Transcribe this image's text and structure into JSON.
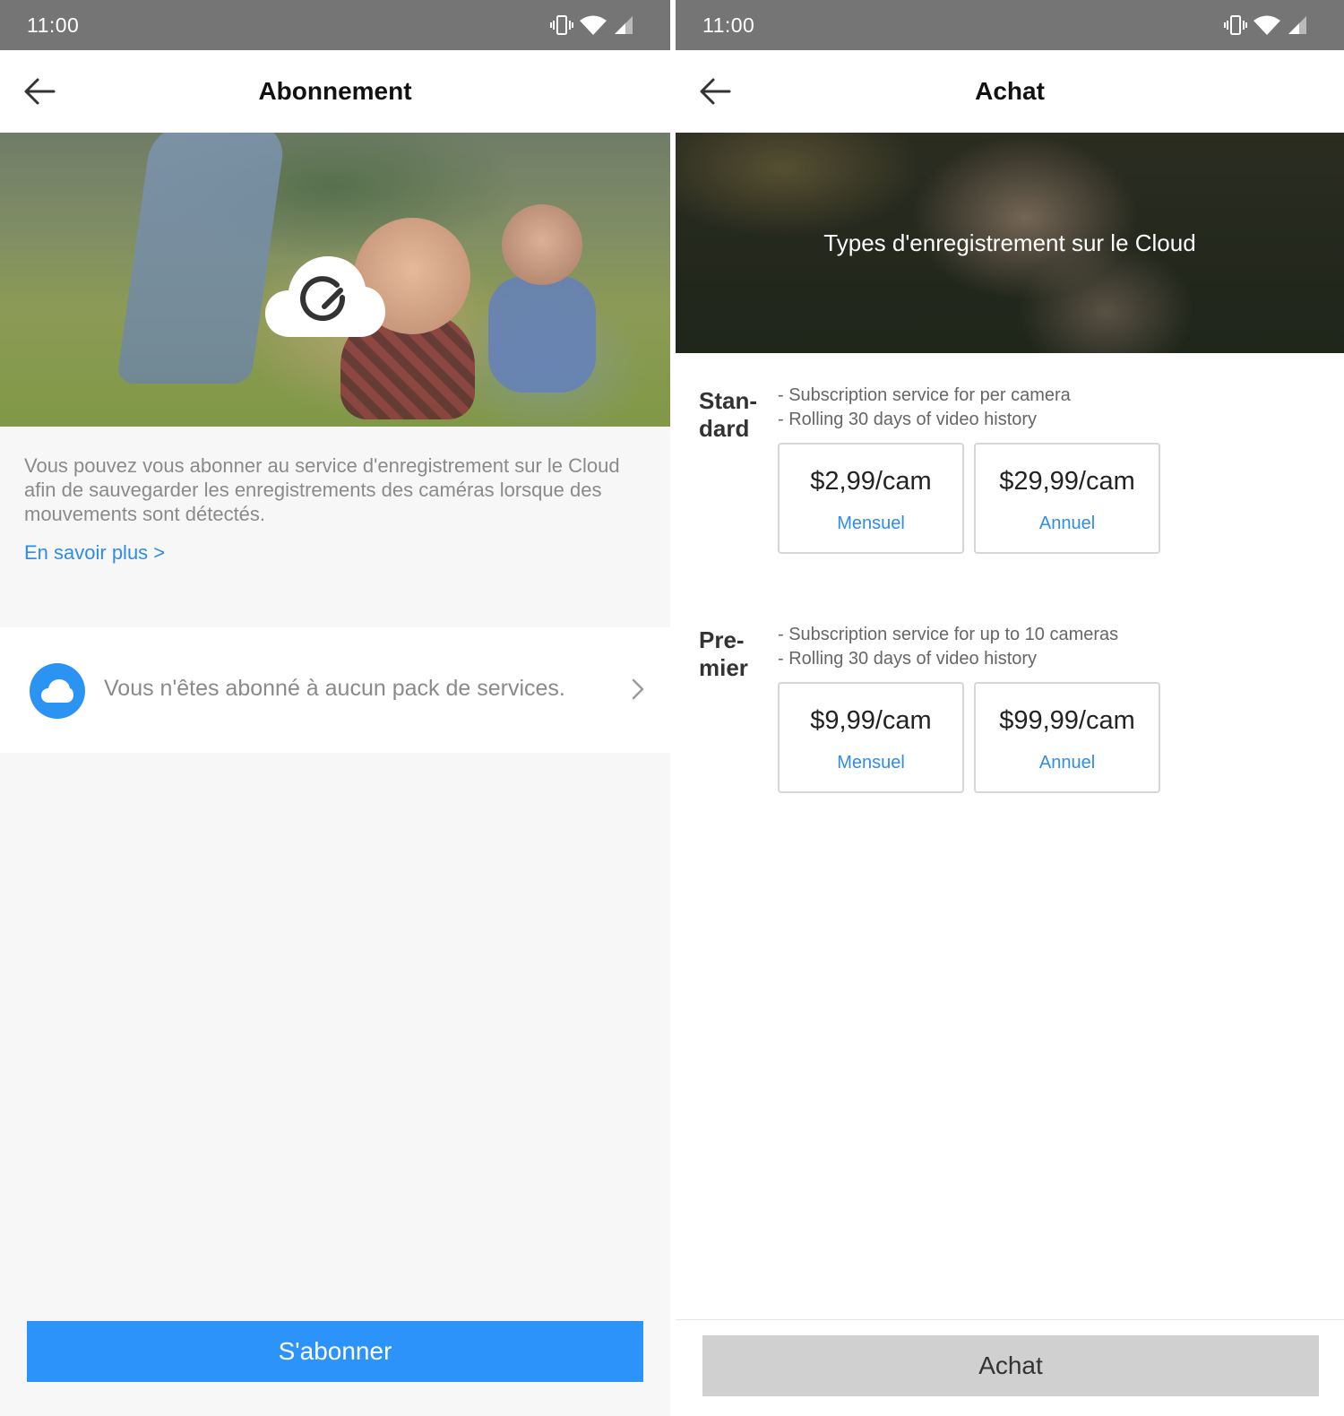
{
  "left_screen": {
    "status_bar": {
      "time": "11:00"
    },
    "app_bar": {
      "title": "Abonnement"
    },
    "description": "Vous pouvez vous abonner au service d'enregistrement sur le Cloud afin de sauvegarder les enregistrements des caméras lorsque des mouvements sont détectés.",
    "learn_more": "En savoir plus >",
    "subscription_status": "Vous n'êtes abonné à aucun pack de services.",
    "subscribe_button": "S'abonner"
  },
  "right_screen": {
    "status_bar": {
      "time": "11:00"
    },
    "app_bar": {
      "title": "Achat"
    },
    "hero_title": "Types d'enregistrement sur le Cloud",
    "plans": [
      {
        "name_line1": "Stan-",
        "name_line2": "dard",
        "features": [
          "- Subscription service for per camera",
          "- Rolling 30 days of video history"
        ],
        "options": [
          {
            "price": "$2,99/cam",
            "period": "Mensuel"
          },
          {
            "price": "$29,99/cam",
            "period": "Annuel"
          }
        ]
      },
      {
        "name_line1": "Pre-",
        "name_line2": "mier",
        "features": [
          "- Subscription service for up to 10 cameras",
          "- Rolling 30 days of video history"
        ],
        "options": [
          {
            "price": "$9,99/cam",
            "period": "Mensuel"
          },
          {
            "price": "$99,99/cam",
            "period": "Annuel"
          }
        ]
      }
    ],
    "buy_button": "Achat"
  },
  "colors": {
    "accent_blue": "#2b93f9",
    "link_blue": "#2f8ce8",
    "status_bar": "#757575",
    "disabled_button": "#d0d0d0"
  },
  "icons": [
    "back-arrow-icon",
    "vibrate-icon",
    "wifi-icon",
    "cellular-signal-icon",
    "cloud-sync-icon",
    "cloud-icon",
    "chevron-right-icon"
  ]
}
